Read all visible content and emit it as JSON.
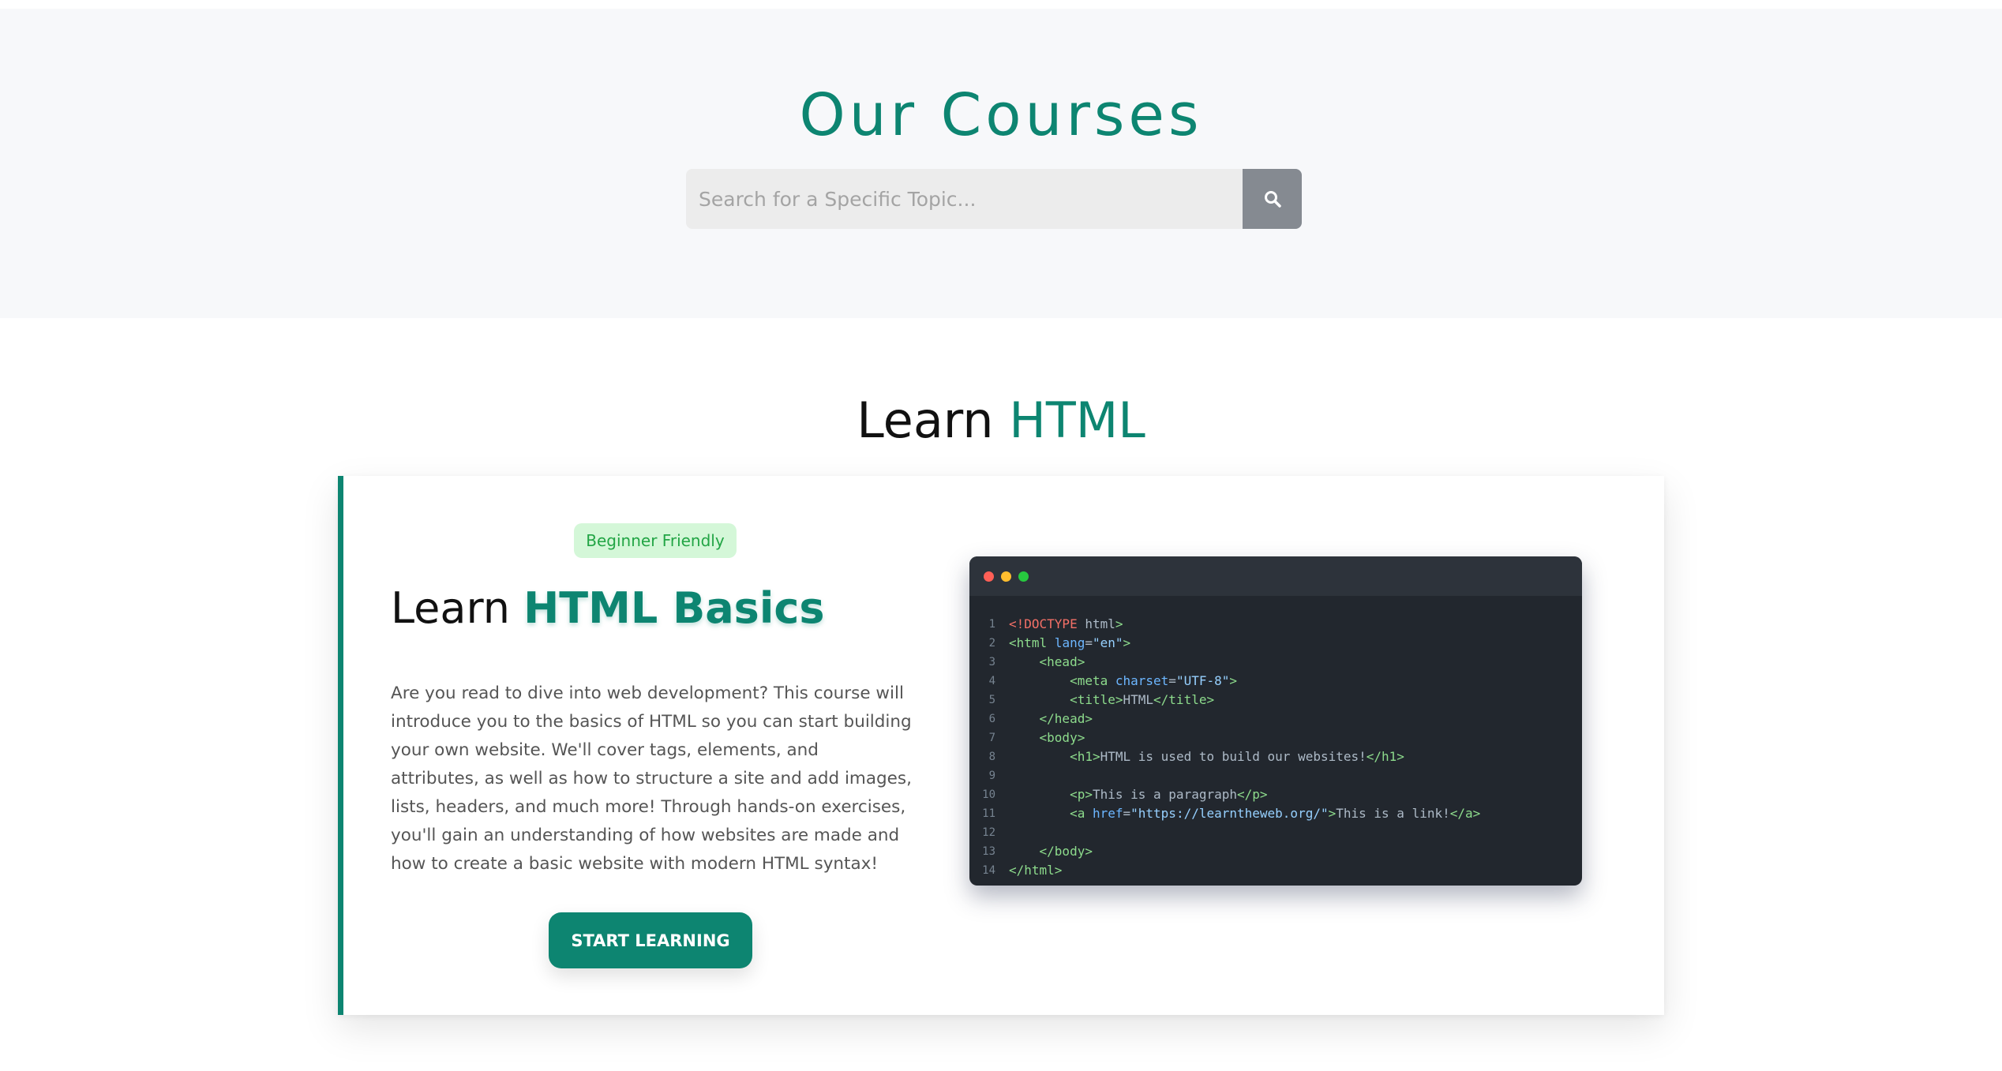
{
  "hero": {
    "title": "Our Courses",
    "search_placeholder": "Search for a Specific Topic...",
    "search_value": ""
  },
  "section": {
    "title_prefix": "Learn",
    "title_accent": "HTML"
  },
  "course": {
    "badge": "Beginner Friendly",
    "title_prefix": "Learn",
    "title_accent": "HTML Basics",
    "description": "Are you read to dive into web development? This course will introduce you to the basics of HTML so you can start building your own website. We'll cover tags, elements, and attributes, as well as how to structure a site and add images, lists, headers, and much more! Through hands-on exercises, you'll gain an understanding of how websites are made and how to create a basic website with modern HTML syntax!",
    "button_label": "START LEARNING"
  },
  "code": {
    "lines": [
      {
        "n": "1",
        "text": "<!DOCTYPE html>"
      },
      {
        "n": "2",
        "text": "<html lang=\"en\">"
      },
      {
        "n": "3",
        "text": "    <head>"
      },
      {
        "n": "4",
        "text": "        <meta charset=\"UTF-8\">"
      },
      {
        "n": "5",
        "text": "        <title>HTML</title>"
      },
      {
        "n": "6",
        "text": "    </head>"
      },
      {
        "n": "7",
        "text": "    <body>"
      },
      {
        "n": "8",
        "text": "        <h1>HTML is used to build our websites!</h1>"
      },
      {
        "n": "9",
        "text": ""
      },
      {
        "n": "10",
        "text": "        <p>This is a paragraph</p>"
      },
      {
        "n": "11",
        "text": "        <a href=\"https://learntheweb.org/\">This is a link!</a>"
      },
      {
        "n": "12",
        "text": ""
      },
      {
        "n": "13",
        "text": "    </body>"
      },
      {
        "n": "14",
        "text": "</html>"
      }
    ]
  },
  "colors": {
    "accent": "#0d8571",
    "badge_bg": "#d4f7d8",
    "badge_text": "#22a545",
    "code_bg": "#22272e"
  },
  "icons": {
    "search": "search-icon"
  }
}
